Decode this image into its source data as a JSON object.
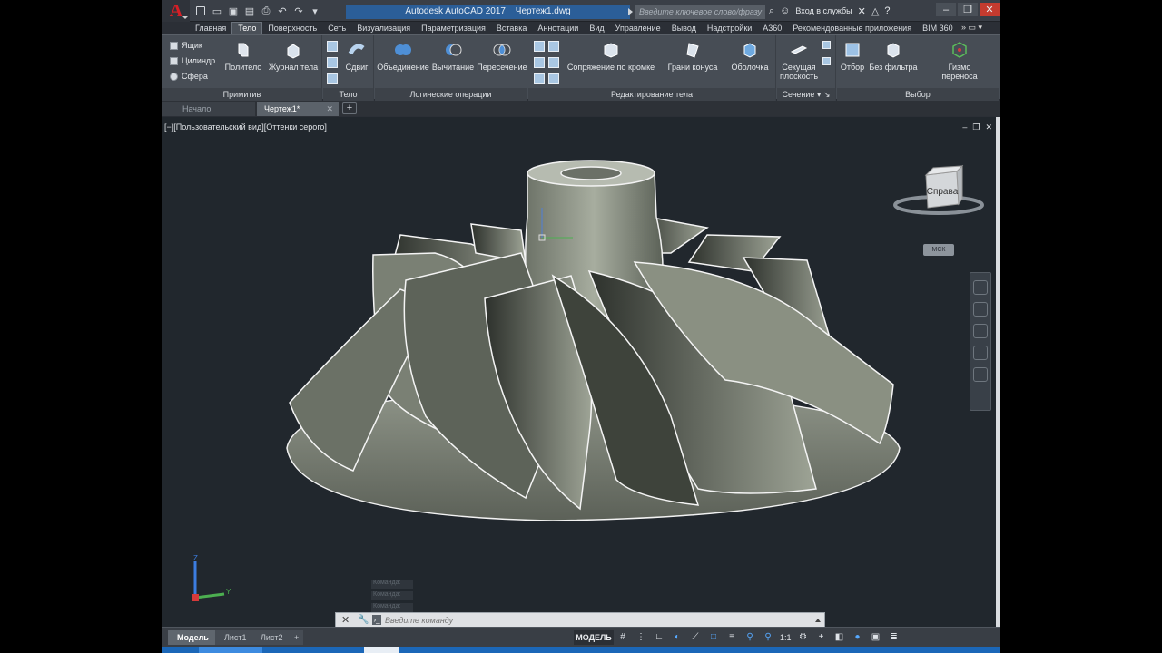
{
  "title": {
    "app_name": "Autodesk AutoCAD 2017",
    "file_name": "Чертеж1.dwg",
    "search_placeholder": "Введите ключевое слово/фразу",
    "signin": "Вход в службы"
  },
  "ribbon_tabs": [
    {
      "label": "Главная"
    },
    {
      "label": "Тело"
    },
    {
      "label": "Поверхность"
    },
    {
      "label": "Сеть"
    },
    {
      "label": "Визуализация"
    },
    {
      "label": "Параметризация"
    },
    {
      "label": "Вставка"
    },
    {
      "label": "Аннотации"
    },
    {
      "label": "Вид"
    },
    {
      "label": "Управление"
    },
    {
      "label": "Вывод"
    },
    {
      "label": "Надстройки"
    },
    {
      "label": "A360"
    },
    {
      "label": "Рекомендованные приложения"
    },
    {
      "label": "BIM 360"
    }
  ],
  "ribbon": {
    "primitives": {
      "label": "Примитив",
      "box": "Ящик",
      "cylinder": "Цилиндр",
      "sphere": "Сфера",
      "polysolid": "Политело",
      "history": "Журнал тела"
    },
    "solid": {
      "label": "Тело",
      "shift": "Сдвиг"
    },
    "boolean": {
      "label": "Логические операции",
      "union": "Объединение",
      "subtract": "Вычитание",
      "intersect": "Пересечение"
    },
    "edit": {
      "label": "Редактирование тела",
      "fillet": "Сопряжение по кромке",
      "taper": "Грани конуса",
      "shell": "Оболочка"
    },
    "section": {
      "label": "Сечение",
      "plane_line1": "Секущая",
      "plane_line2": "плоскость"
    },
    "selection": {
      "label": "Выбор",
      "culling": "Отбор",
      "nofilter": "Без фильтра",
      "gizmo_line1": "Гизмо",
      "gizmo_line2": "переноса"
    }
  },
  "file_tabs": {
    "start": "Начало",
    "drawing": "Чертеж1*"
  },
  "viewport": {
    "label": "[−][Пользовательский вид][Оттенки серого]",
    "viewcube_face": "Справа",
    "wcs": "МСК",
    "ucs_z": "Z",
    "ucs_y": "Y"
  },
  "command": {
    "placeholder": "Введите команду",
    "history": [
      "Команда:",
      "Команда:",
      "Команда:"
    ]
  },
  "layout_tabs": [
    "Модель",
    "Лист1",
    "Лист2"
  ],
  "status": {
    "model": "МОДЕЛЬ",
    "scale": "1:1"
  },
  "colors": {
    "accent": "#2b5e98",
    "logo": "#d61f26",
    "viewport_bg": "#21272d"
  }
}
